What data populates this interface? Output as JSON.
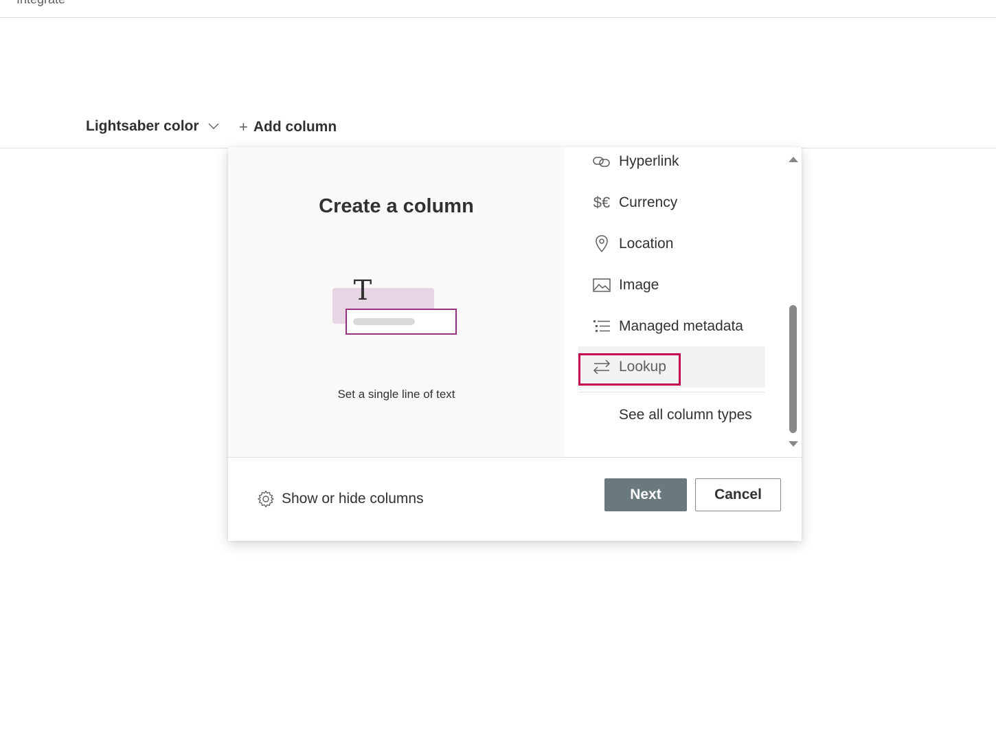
{
  "topbar": {
    "partial_text": "Integrate"
  },
  "column_header": {
    "label": "Lightsaber color",
    "add_column_label": "Add column",
    "add_symbol": "+"
  },
  "panel": {
    "title": "Create a column",
    "description": "Set a single line of text",
    "illustration_glyph": "T",
    "column_types": [
      {
        "label": "Hyperlink",
        "icon": "link-icon"
      },
      {
        "label": "Currency",
        "icon": "currency-icon",
        "glyph": "$€"
      },
      {
        "label": "Location",
        "icon": "location-pin-icon"
      },
      {
        "label": "Image",
        "icon": "image-icon"
      },
      {
        "label": "Managed metadata",
        "icon": "managed-metadata-icon"
      },
      {
        "label": "Lookup",
        "icon": "lookup-arrows-icon",
        "selected": true
      }
    ],
    "see_all_label": "See all column types",
    "footer": {
      "show_hide_label": "Show or hide columns",
      "next_label": "Next",
      "cancel_label": "Cancel"
    }
  },
  "colors": {
    "highlight": "#c30052",
    "next_button": "#69797e",
    "illustration_fill": "#e8d5e3",
    "illustration_border": "#9b2f84"
  }
}
